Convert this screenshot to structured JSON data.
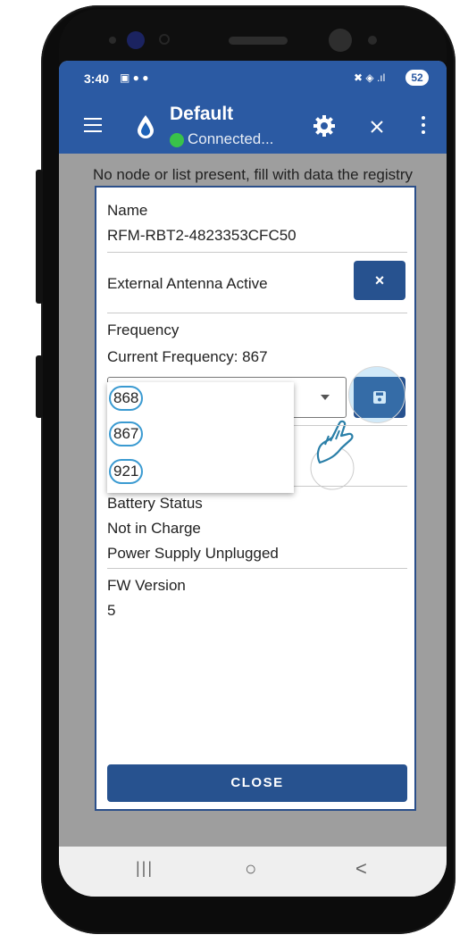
{
  "status_bar": {
    "time": "3:40",
    "left_icons": "▣ ● ●",
    "right_icons": "✖ ◈ .ıl",
    "battery": "52"
  },
  "app_bar": {
    "title": "Default",
    "connection_status": "Connected..."
  },
  "message": "No node or list present, fill with data the registry",
  "dialog": {
    "name_label": "Name",
    "name_value": "RFM-RBT2-4823353CFC50",
    "antenna_label": "External Antenna Active",
    "antenna_button": "×",
    "frequency_label": "Frequency",
    "current_frequency": "Current Frequency: 867",
    "frequency_options": [
      "868",
      "867",
      "921"
    ],
    "battery_label": "Battery Status",
    "battery_charge": "Not in Charge",
    "power_supply": "Power Supply Unplugged",
    "fw_label": "FW Version",
    "fw_value": "5",
    "close_label": "CLOSE"
  },
  "nav_bar": {
    "recents": "|||",
    "home": "○",
    "back": "<"
  },
  "colors": {
    "app_bar": "#2b5aa3",
    "button": "#27528f",
    "connected_dot": "#39c24a",
    "highlight_ring": "#3a9ad1"
  }
}
